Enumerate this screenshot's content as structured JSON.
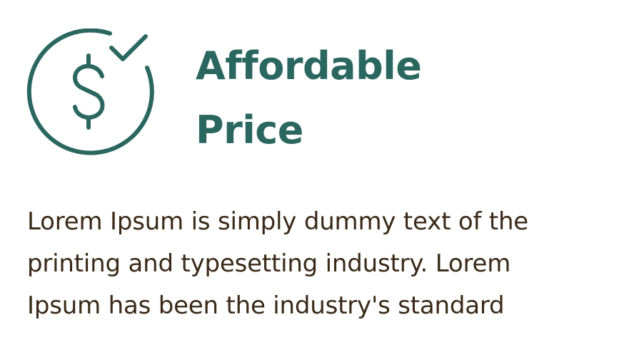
{
  "feature": {
    "icon": "dollar-check-icon",
    "title_lines": [
      "Affordable",
      "Price"
    ],
    "description_lines": [
      "Lorem Ipsum is simply dummy text of the",
      "printing and typesetting industry. Lorem",
      "Ipsum has been the industry's standard"
    ]
  },
  "colors": {
    "accent": "#2a6760",
    "body_text": "#3a2a17",
    "background": "#ffffff"
  }
}
